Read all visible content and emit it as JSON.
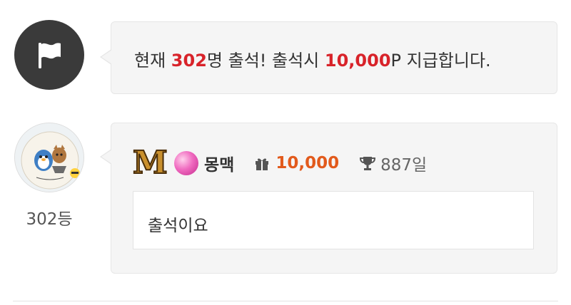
{
  "notice": {
    "prefix": "현재 ",
    "count": "302",
    "middle": "명 출석! 출석시 ",
    "points": "10,000",
    "suffix": "P 지급합니다."
  },
  "entry": {
    "rank": "302등",
    "level_badge": "M",
    "nickname": "몽맥",
    "points": "10,000",
    "days": "887일",
    "comment": "출석이요"
  },
  "icons": {
    "notice": "flag-icon",
    "level": "level-m-icon",
    "candy": "candy-icon",
    "points": "gift-icon",
    "days": "trophy-icon"
  },
  "colors": {
    "accent_red": "#d8232a",
    "points_orange": "#e25a1c",
    "flag_bg": "#3a3a3a"
  }
}
